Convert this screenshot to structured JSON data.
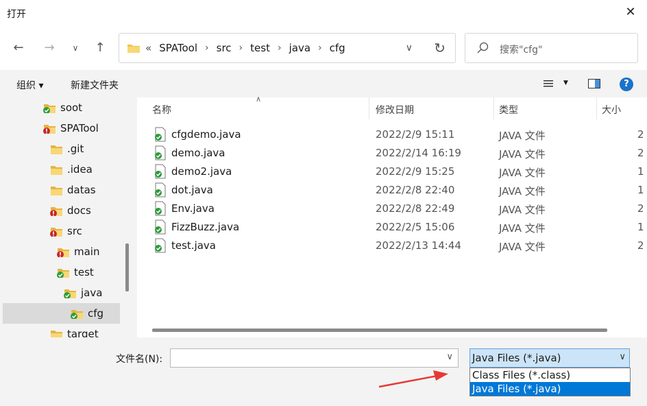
{
  "window": {
    "title": "打开",
    "close_icon": "close-icon"
  },
  "nav": {
    "back_icon": "arrow-left-icon",
    "forward_icon": "arrow-right-icon",
    "recent_icon": "chevron-down-icon",
    "up_icon": "arrow-up-icon",
    "address": {
      "prefix": "«",
      "crumbs": [
        "SPATool",
        "src",
        "test",
        "java",
        "cfg"
      ]
    },
    "search_placeholder": "搜索\"cfg\""
  },
  "toolbar": {
    "organize": "组织 ▾",
    "new_folder": "新建文件夹",
    "help": "?"
  },
  "tree": [
    {
      "label": "soot",
      "badge": "ok"
    },
    {
      "label": "SPATool",
      "badge": "err"
    },
    {
      "label": ".git",
      "badge": "none"
    },
    {
      "label": ".idea",
      "badge": "none"
    },
    {
      "label": "datas",
      "badge": "none"
    },
    {
      "label": "docs",
      "badge": "err"
    },
    {
      "label": "src",
      "badge": "err"
    },
    {
      "label": "main",
      "badge": "err"
    },
    {
      "label": "test",
      "badge": "ok"
    },
    {
      "label": "java",
      "badge": "ok"
    },
    {
      "label": "cfg",
      "badge": "ok",
      "selected": true
    },
    {
      "label": "target",
      "badge": "none"
    }
  ],
  "columns": {
    "name": "名称",
    "date": "修改日期",
    "type": "类型",
    "size": "大小"
  },
  "files": [
    {
      "name": "cfgdemo.java",
      "date": "2022/2/9 15:11",
      "type": "JAVA 文件",
      "size": "2"
    },
    {
      "name": "demo.java",
      "date": "2022/2/14 16:19",
      "type": "JAVA 文件",
      "size": "2"
    },
    {
      "name": "demo2.java",
      "date": "2022/2/9 15:25",
      "type": "JAVA 文件",
      "size": "1"
    },
    {
      "name": "dot.java",
      "date": "2022/2/8 22:40",
      "type": "JAVA 文件",
      "size": "1"
    },
    {
      "name": "Env.java",
      "date": "2022/2/8 22:49",
      "type": "JAVA 文件",
      "size": "2"
    },
    {
      "name": "FizzBuzz.java",
      "date": "2022/2/5 15:06",
      "type": "JAVA 文件",
      "size": "1"
    },
    {
      "name": "test.java",
      "date": "2022/2/13 14:44",
      "type": "JAVA 文件",
      "size": "2"
    }
  ],
  "bottom": {
    "filename_label": "文件名(N):",
    "filename_value": "",
    "filetype_selected": "Java Files (*.java)",
    "filetype_options": [
      "Class Files (*.class)",
      "Java Files (*.java)"
    ]
  },
  "colors": {
    "accent": "#0078d7",
    "select_bg": "#cce4f7",
    "arrow": "#e53935"
  }
}
